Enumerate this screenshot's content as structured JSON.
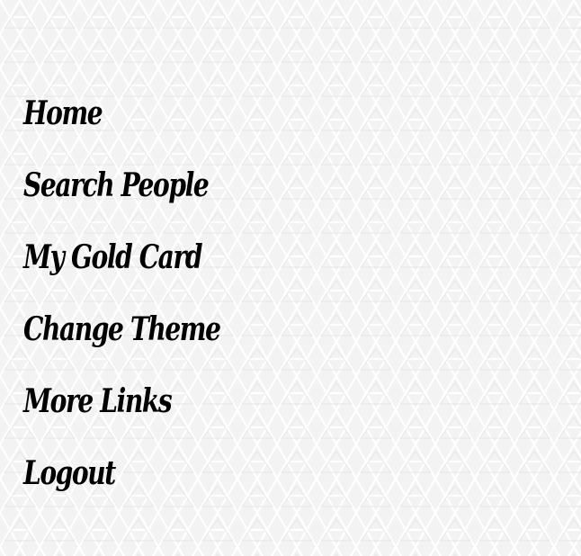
{
  "background": {
    "base_color": "#f3f3f3",
    "pattern_color": "#ffffff",
    "pattern": "triangle-lattice"
  },
  "menu": {
    "text_color": "#000000",
    "items": [
      {
        "label": "Home"
      },
      {
        "label": "Search People"
      },
      {
        "label": "My Gold Card"
      },
      {
        "label": "Change Theme"
      },
      {
        "label": "More Links"
      },
      {
        "label": "Logout"
      }
    ]
  }
}
